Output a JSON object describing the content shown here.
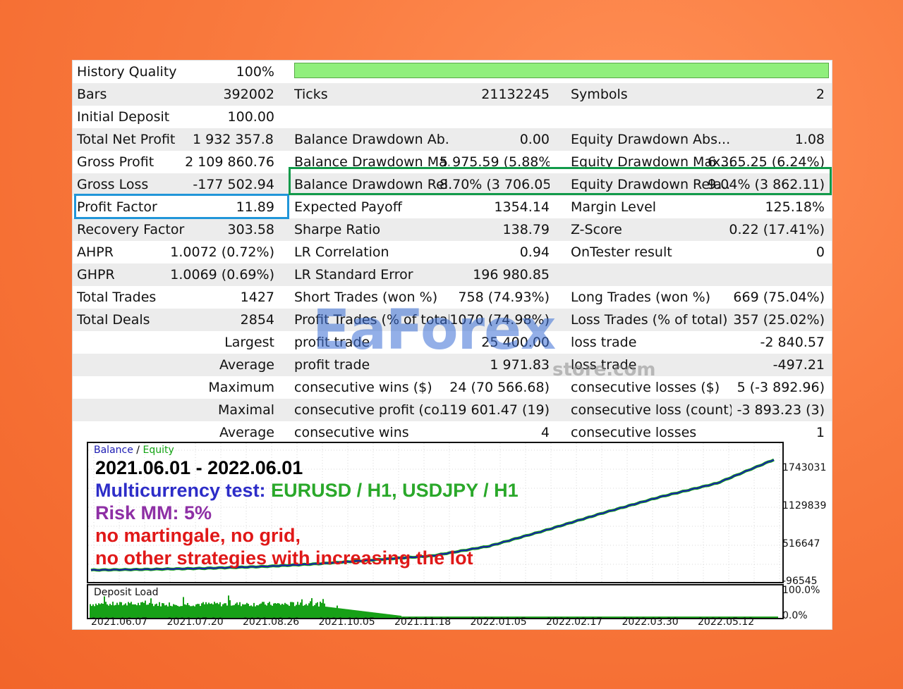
{
  "report": {
    "rows": [
      {
        "cells": [
          "History Quality",
          "100%"
        ]
      },
      {
        "cells": [
          "Bars",
          "392002",
          "Ticks",
          "21132245",
          "Symbols",
          "2"
        ]
      },
      {
        "cells": [
          "Initial Deposit",
          "100.00"
        ]
      },
      {
        "cells": [
          "Total Net Profit",
          "1 932 357.82",
          "Balance Drawdown Ab...",
          "0.00",
          "Equity Drawdown Abs...",
          "1.08"
        ]
      },
      {
        "cells": [
          "Gross Profit",
          "2 109 860.76",
          "Balance Drawdown Ma...",
          "5 975.59 (5.88%)",
          "Equity Drawdown Max...",
          "6 365.25 (6.24%)"
        ]
      },
      {
        "cells": [
          "Gross Loss",
          "-177 502.94",
          "Balance Drawdown Rel...",
          "8.70% (3 706.05)",
          "Equity Drawdown Rela...",
          "9.04% (3 862.11)"
        ]
      },
      {
        "cells": [
          "Profit Factor",
          "11.89",
          "Expected Payoff",
          "1354.14",
          "Margin Level",
          "125.18%"
        ]
      },
      {
        "cells": [
          "Recovery Factor",
          "303.58",
          "Sharpe Ratio",
          "138.79",
          "Z-Score",
          "0.22 (17.41%)"
        ]
      },
      {
        "cells": [
          "AHPR",
          "1.0072 (0.72%)",
          "LR Correlation",
          "0.94",
          "OnTester result",
          "0"
        ]
      },
      {
        "cells": [
          "GHPR",
          "1.0069 (0.69%)",
          "LR Standard Error",
          "196 980.85",
          "",
          ""
        ]
      },
      {
        "cells": [
          "Total Trades",
          "1427",
          "Short Trades (won %)",
          "758 (74.93%)",
          "Long Trades (won %)",
          "669 (75.04%)"
        ]
      },
      {
        "cells": [
          "Total Deals",
          "2854",
          "Profit Trades (% of total)",
          "1070 (74.98%)",
          "Loss Trades (% of total)",
          "357 (25.02%)"
        ]
      },
      {
        "cells": [
          "",
          "Largest",
          "profit trade",
          "25 400.00",
          "loss trade",
          "-2 840.57"
        ]
      },
      {
        "cells": [
          "",
          "Average",
          "profit trade",
          "1 971.83",
          "loss trade",
          "-497.21"
        ]
      },
      {
        "cells": [
          "",
          "Maximum",
          "consecutive wins ($)",
          "24 (70 566.68)",
          "consecutive losses ($)",
          "5 (-3 892.96)"
        ]
      },
      {
        "cells": [
          "",
          "Maximal",
          "consecutive profit (co...",
          "119 601.47 (19)",
          "consecutive loss (count)",
          "-3 893.23 (3)"
        ]
      },
      {
        "cells": [
          "",
          "Average",
          "consecutive wins",
          "4",
          "consecutive losses",
          "1"
        ]
      }
    ]
  },
  "watermark": {
    "text": "EaForex",
    "subtext": "store.com"
  },
  "balance_chart": {
    "legend_balance": "Balance",
    "legend_sep": " / ",
    "legend_equity": "Equity",
    "date_range": "2021.06.01 - 2022.06.01",
    "test_prefix": "Multicurrency test: ",
    "test_symbols": "EURUSD / H1, USDJPY / H1",
    "risk": "Risk MM: 5%",
    "note1": "no martingale, no grid,",
    "note2": "no other strategies with increasing the lot",
    "y_ticks": [
      "1743031",
      "1129839",
      "516647",
      "-96545"
    ],
    "colors": {
      "balance": "#1b1bb3",
      "equity": "#12a312",
      "dates": "#000000",
      "test": "#2d2dc8",
      "risk": "#8e2fa5",
      "notes": "#e01818"
    }
  },
  "load_chart": {
    "title": "Deposit Load",
    "y_ticks": [
      "100.0%",
      "0.0%"
    ],
    "x_ticks": [
      "2021.06.07",
      "2021.07.20",
      "2021.08.26",
      "2021.10.05",
      "2021.11.18",
      "2022.01.05",
      "2022.02.17",
      "2022.03.30",
      "2022.05.12"
    ],
    "color": "#17a117"
  },
  "chart_data": {
    "type": "line",
    "series": [
      {
        "name": "Balance",
        "x": [
          "2021.06",
          "2021.07",
          "2021.08",
          "2021.09",
          "2021.10",
          "2021.11",
          "2021.12",
          "2022.01",
          "2022.02",
          "2022.03",
          "2022.04",
          "2022.05",
          "2022.06"
        ],
        "values": [
          100,
          12000,
          30000,
          60000,
          110000,
          180000,
          250000,
          420000,
          700000,
          1000000,
          1280000,
          1520000,
          1932457
        ]
      },
      {
        "name": "Equity",
        "x": [
          "2021.06",
          "2021.07",
          "2021.08",
          "2021.09",
          "2021.10",
          "2021.11",
          "2021.12",
          "2022.01",
          "2022.02",
          "2022.03",
          "2022.04",
          "2022.05",
          "2022.06"
        ],
        "values": [
          100,
          12000,
          30000,
          60000,
          110000,
          180000,
          250000,
          420000,
          700000,
          1000000,
          1280000,
          1520000,
          1932457
        ]
      }
    ],
    "xlabel": "",
    "ylabel": "",
    "ylim": [
      -96545,
      2000000
    ]
  }
}
